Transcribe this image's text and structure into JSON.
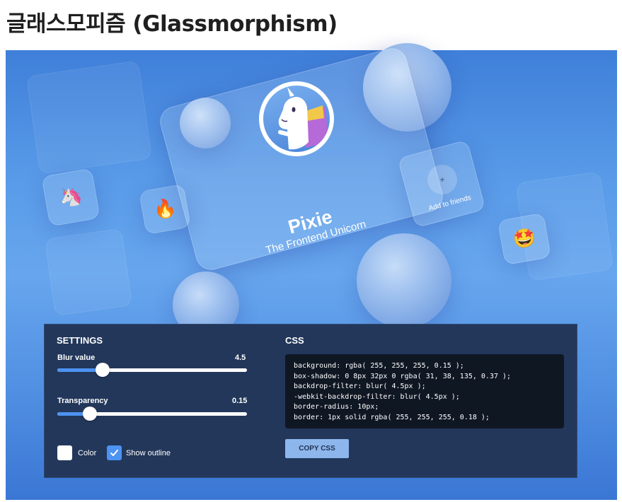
{
  "page": {
    "title": "글래스모피즘 (Glassmorphism)"
  },
  "card": {
    "name": "Pixie",
    "subtitle": "The Frontend Unicorn"
  },
  "friend_card": {
    "plus_symbol": "+",
    "label": "Add to friends"
  },
  "emojis": {
    "unicorn": "🦄",
    "fire": "🔥",
    "star_struck": "🤩"
  },
  "settings": {
    "title": "SETTINGS",
    "blur": {
      "label": "Blur value",
      "value": "4.5",
      "fill_fraction": 0.24
    },
    "transparency": {
      "label": "Transparency",
      "value": "0.15",
      "fill_fraction": 0.17
    },
    "color": {
      "label": "Color",
      "checked": false
    },
    "outline": {
      "label": "Show outline",
      "checked": true
    }
  },
  "css": {
    "title": "CSS",
    "lines": [
      "background: rgba( 255, 255, 255, 0.15 );",
      "box-shadow: 0 8px 32px 0 rgba( 31, 38, 135, 0.37 );",
      "backdrop-filter: blur( 4.5px );",
      "-webkit-backdrop-filter: blur( 4.5px );",
      "border-radius: 10px;",
      "border: 1px solid rgba( 255, 255, 255, 0.18 );"
    ],
    "copy_button": "COPY CSS"
  },
  "colors": {
    "panel_bg": "#22375a",
    "slider_fill": "#4c93f2",
    "checkbox_checked": "#4c93f2",
    "copy_button_bg": "#8db6ec"
  }
}
